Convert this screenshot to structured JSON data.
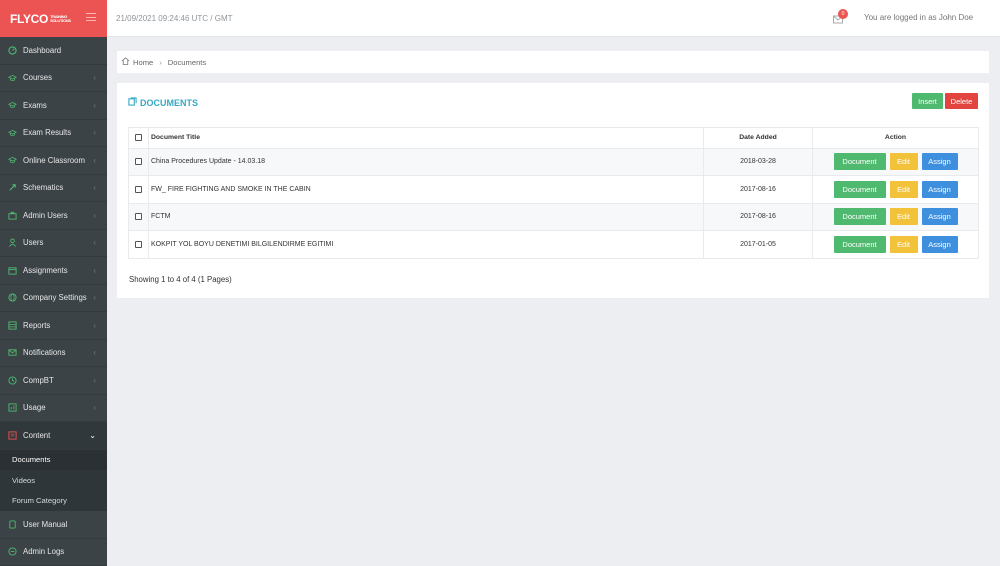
{
  "brand": {
    "logo": "FLYCO",
    "sub_line1": "TRAINING",
    "sub_line2": "SOLUTIONS",
    "accent": "#ec5353"
  },
  "topbar": {
    "datetime": "21/09/2021 09:24:46 UTC / GMT",
    "notification_count": "0",
    "user_text": "You are logged in as John Doe"
  },
  "sidebar": {
    "items": [
      {
        "label": "Dashboard",
        "icon": "dashboard-icon"
      },
      {
        "label": "Courses",
        "icon": "graduation-cap-icon"
      },
      {
        "label": "Exams",
        "icon": "graduation-cap-icon"
      },
      {
        "label": "Exam Results",
        "icon": "graduation-cap-icon"
      },
      {
        "label": "Online Classroom",
        "icon": "graduation-cap-icon"
      },
      {
        "label": "Schematics",
        "icon": "share-icon"
      },
      {
        "label": "Admin Users",
        "icon": "briefcase-icon"
      },
      {
        "label": "Users",
        "icon": "user-icon"
      },
      {
        "label": "Assignments",
        "icon": "calendar-icon"
      },
      {
        "label": "Company Settings",
        "icon": "globe-icon"
      },
      {
        "label": "Reports",
        "icon": "table-icon"
      },
      {
        "label": "Notifications",
        "icon": "envelope-icon"
      },
      {
        "label": "CompBT",
        "icon": "clock-icon"
      },
      {
        "label": "Usage",
        "icon": "bar-chart-icon"
      },
      {
        "label": "Content",
        "icon": "content-icon"
      }
    ],
    "submenu": [
      {
        "label": "Documents"
      },
      {
        "label": "Videos"
      },
      {
        "label": "Forum Category"
      }
    ],
    "bottom_items": [
      {
        "label": "User Manual",
        "icon": "book-icon"
      },
      {
        "label": "Admin Logs",
        "icon": "logs-icon"
      }
    ]
  },
  "breadcrumb": {
    "home": "Home",
    "current": "Documents"
  },
  "panel": {
    "title": "DOCUMENTS",
    "insert_label": "Insert",
    "delete_label": "Delete",
    "columns": {
      "title": "Document Title",
      "date": "Date Added",
      "action": "Action"
    },
    "rows": [
      {
        "title": "China Procedures Update - 14.03.18",
        "date": "2018-03-28"
      },
      {
        "title": "FW_ FIRE FIGHTING AND SMOKE IN THE CABIN",
        "date": "2017-08-16"
      },
      {
        "title": "FCTM",
        "date": "2017-08-16"
      },
      {
        "title": "KOKPIT YOL BOYU DENETIMI BILGILENDIRME EGITIMI",
        "date": "2017-01-05"
      }
    ],
    "action_labels": {
      "document": "Document",
      "edit": "Edit",
      "assign": "Assign"
    },
    "showing": "Showing 1 to 4 of 4 (1 Pages)"
  }
}
